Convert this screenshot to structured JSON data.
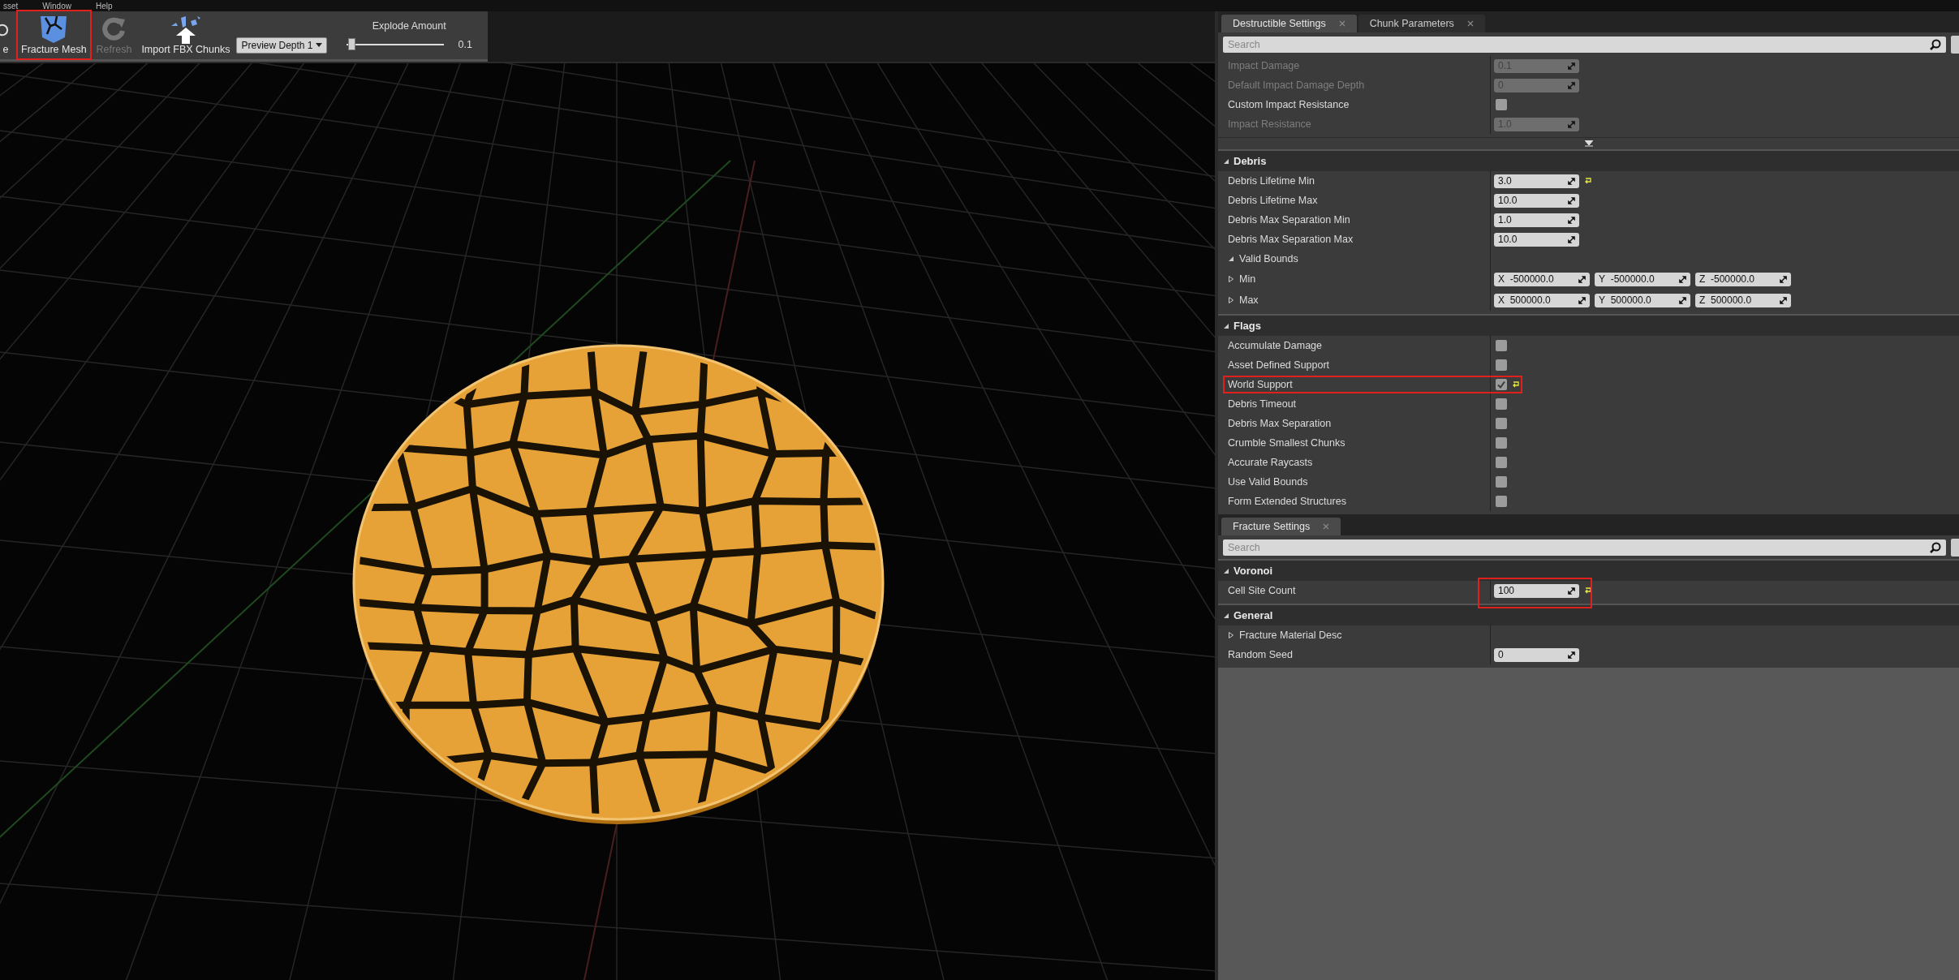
{
  "menu": [
    "sset",
    "Window",
    "Help"
  ],
  "toolbar": {
    "items": [
      {
        "label": "e",
        "disabled": false,
        "highlighted": false
      },
      {
        "label": "Fracture Mesh",
        "disabled": false,
        "highlighted": true
      },
      {
        "label": "Refresh",
        "disabled": true,
        "highlighted": false
      },
      {
        "label": "Import FBX Chunks",
        "disabled": false,
        "highlighted": false
      }
    ],
    "dropdown": {
      "label": "Preview Depth 1"
    },
    "slider": {
      "label": "Explode Amount",
      "level": 0.05,
      "reading": "0.1"
    }
  },
  "panels": [
    {
      "tabs": [
        {
          "label": "Destructible Settings",
          "selected": true
        },
        {
          "label": "Chunk Parameters",
          "selected": false
        }
      ],
      "search": {
        "placeholder": "Search"
      },
      "sections": [
        {
          "more_below": true,
          "rows": [
            {
              "kind": "number",
              "label": "Impact Damage",
              "value": "0.1",
              "disabled": true
            },
            {
              "kind": "number",
              "label": "Default Impact Damage Depth",
              "value": "0",
              "disabled": true
            },
            {
              "kind": "checkbox",
              "label": "Custom Impact Resistance",
              "checked": false,
              "disabled": false
            },
            {
              "kind": "number",
              "label": "Impact Resistance",
              "value": "1.0",
              "disabled": true
            }
          ]
        },
        {
          "title": "Debris",
          "expanded": true,
          "rows": [
            {
              "kind": "number",
              "label": "Debris Lifetime Min",
              "value": "3.0",
              "disabled": false,
              "changed": true
            },
            {
              "kind": "number",
              "label": "Debris Lifetime Max",
              "value": "10.0",
              "disabled": false
            },
            {
              "kind": "number",
              "label": "Debris Max Separation Min",
              "value": "1.0",
              "disabled": false
            },
            {
              "kind": "number",
              "label": "Debris Max Separation Max",
              "value": "10.0",
              "disabled": false
            },
            {
              "kind": "group",
              "label": "Valid Bounds",
              "expanded": true,
              "children": [
                {
                  "kind": "vector",
                  "label": "Min",
                  "expanded": false,
                  "components": [
                    {
                      "axis": "X",
                      "value": "-500000.0"
                    },
                    {
                      "axis": "Y",
                      "value": "-500000.0"
                    },
                    {
                      "axis": "Z",
                      "value": "-500000.0"
                    }
                  ]
                },
                {
                  "kind": "vector",
                  "label": "Max",
                  "expanded": false,
                  "components": [
                    {
                      "axis": "X",
                      "value": "500000.0"
                    },
                    {
                      "axis": "Y",
                      "value": "500000.0"
                    },
                    {
                      "axis": "Z",
                      "value": "500000.0"
                    }
                  ]
                }
              ]
            }
          ]
        },
        {
          "title": "Flags",
          "expanded": true,
          "rows": [
            {
              "kind": "checkbox",
              "label": "Accumulate Damage",
              "checked": false,
              "disabled": false
            },
            {
              "kind": "checkbox",
              "label": "Asset Defined Support",
              "checked": false,
              "disabled": false
            },
            {
              "kind": "checkbox",
              "label": "World Support",
              "checked": true,
              "disabled": false,
              "changed": true,
              "highlighted": true
            },
            {
              "kind": "checkbox",
              "label": "Debris Timeout",
              "checked": false,
              "disabled": false
            },
            {
              "kind": "checkbox",
              "label": "Debris Max Separation",
              "checked": false,
              "disabled": false
            },
            {
              "kind": "checkbox",
              "label": "Crumble Smallest Chunks",
              "checked": false,
              "disabled": false
            },
            {
              "kind": "checkbox",
              "label": "Accurate Raycasts",
              "checked": false,
              "disabled": false
            },
            {
              "kind": "checkbox",
              "label": "Use Valid Bounds",
              "checked": false,
              "disabled": false
            },
            {
              "kind": "checkbox",
              "label": "Form Extended Structures",
              "checked": false,
              "disabled": false
            }
          ]
        }
      ]
    },
    {
      "tabs": [
        {
          "label": "Fracture Settings",
          "selected": true
        }
      ],
      "search": {
        "placeholder": "Search"
      },
      "sections": [
        {
          "title": "Voronoi",
          "expanded": true,
          "rows": [
            {
              "kind": "number",
              "label": "Cell Site Count",
              "value": "100",
              "disabled": false,
              "changed": true,
              "highlighted": true
            }
          ]
        },
        {
          "title": "General",
          "expanded": true,
          "rows": [
            {
              "kind": "struct",
              "label": "Fracture Material Desc",
              "expanded": false
            },
            {
              "kind": "number",
              "label": "Random Seed",
              "value": "0",
              "disabled": false
            }
          ]
        }
      ]
    }
  ]
}
